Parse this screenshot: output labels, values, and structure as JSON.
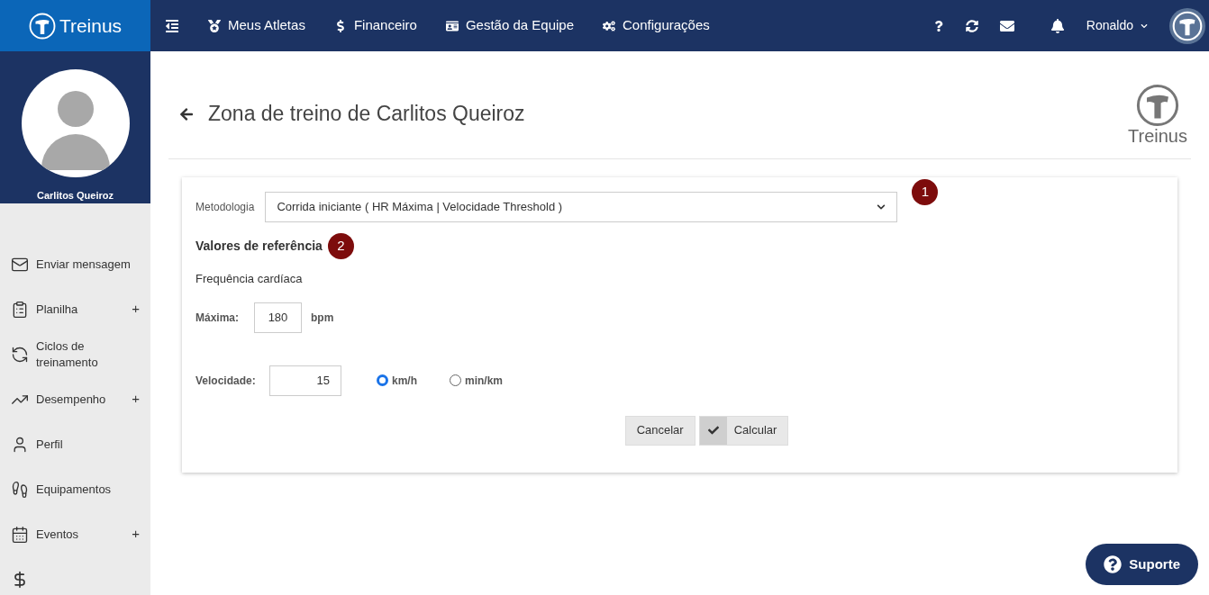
{
  "brand": {
    "name": "Treinus"
  },
  "top_nav": [
    {
      "label": "Meus Atletas"
    },
    {
      "label": "Financeiro"
    },
    {
      "label": "Gestão da Equipe"
    },
    {
      "label": "Configurações"
    }
  ],
  "user_menu": {
    "name": "Ronaldo"
  },
  "profile": {
    "name": "Carlitos Queiroz"
  },
  "sidebar": {
    "items": [
      {
        "label": "Enviar mensagem"
      },
      {
        "label": "Planilha",
        "toggle": "+"
      },
      {
        "label": "Ciclos de treinamento"
      },
      {
        "label": "Desempenho",
        "toggle": "+"
      },
      {
        "label": "Perfil"
      },
      {
        "label": "Equipamentos"
      },
      {
        "label": "Eventos",
        "toggle": "+"
      }
    ]
  },
  "page": {
    "title": "Zona de treino de Carlitos Queiroz",
    "logo_text": "Treinus"
  },
  "form": {
    "methodology_label": "Metodologia",
    "methodology_value": "Corrida iniciante ( HR Máxima | Velocidade Threshold )",
    "methodology_badge": "1",
    "section_title": "Valores de referência",
    "section_badge": "2",
    "heart_rate_title": "Frequência cardíaca",
    "max_label": "Máxima:",
    "max_value": "180",
    "max_unit": "bpm",
    "speed_label": "Velocidade:",
    "speed_value": "15",
    "speed_units": [
      {
        "label": "km/h",
        "selected": true
      },
      {
        "label": "min/km",
        "selected": false
      }
    ],
    "buttons": [
      {
        "label": "Cancelar",
        "kind": "plain"
      },
      {
        "label": "Calcular",
        "kind": "check"
      }
    ]
  },
  "support_button": {
    "label": "Suporte"
  }
}
